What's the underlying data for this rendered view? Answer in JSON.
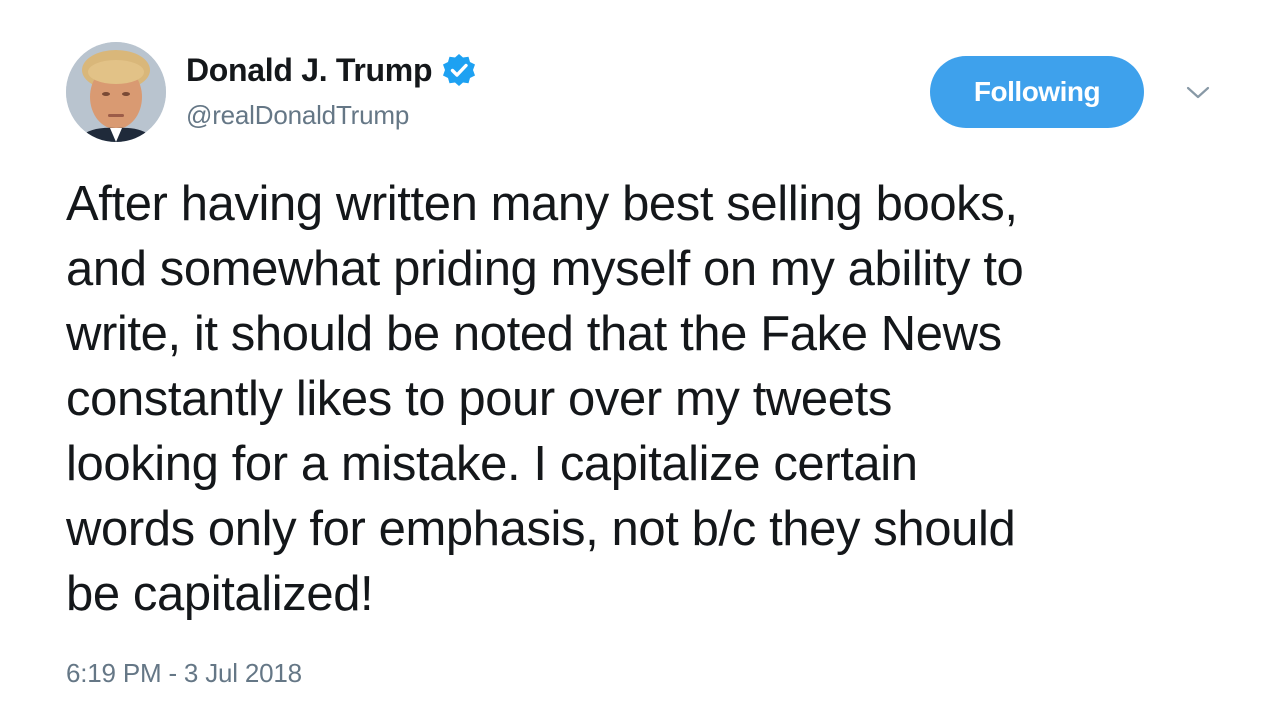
{
  "author": {
    "display_name": "Donald J. Trump",
    "handle": "@realDonaldTrump",
    "verified": true
  },
  "follow_button": {
    "label": "Following",
    "color": "#3ea1ec"
  },
  "menu": {
    "caret_icon": "chevron-down-icon"
  },
  "tweet": {
    "lines": [
      "After having written many best selling books,",
      "and somewhat priding myself on my ability to",
      "write, it should be noted that the Fake News",
      "constantly likes to pour over my tweets",
      "looking for a mistake. I capitalize certain",
      "words only for emphasis, not b/c they should",
      "be capitalized!"
    ],
    "timestamp": "6:19 PM - 3 Jul 2018"
  },
  "colors": {
    "text": "#14171a",
    "secondary": "#657786",
    "verified_blue": "#1da1f2"
  }
}
